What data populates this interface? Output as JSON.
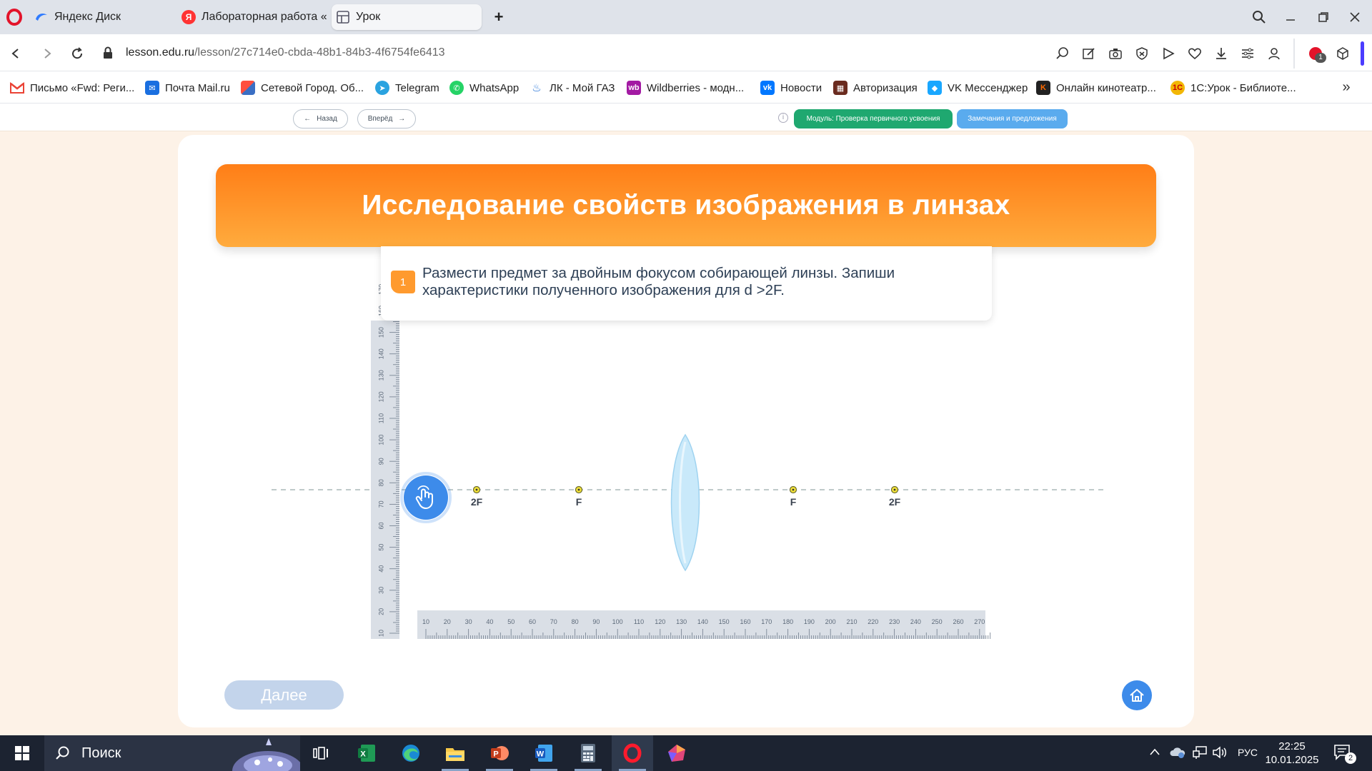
{
  "browser": {
    "tabs": [
      {
        "label": "Яндекс Диск",
        "icon": "yandex-disk-icon"
      },
      {
        "label": "Лабораторная работа «И",
        "icon": "yandex-icon"
      },
      {
        "label": "Урок",
        "icon": "lesson-page-icon",
        "active": true
      }
    ],
    "new_tab": "+",
    "url_host": "lesson.edu.ru",
    "url_path": "/lesson/27c714e0-cbda-48b1-84b3-4f6754fe6413",
    "extension_badge": "1",
    "bookmarks": [
      {
        "label": "Письмо «Fwd: Реги...",
        "icon": "gmail-icon",
        "color": "#ea4335"
      },
      {
        "label": "Почта Mail.ru",
        "icon": "mail-ru-icon",
        "color": "#1a6fe0"
      },
      {
        "label": "Сетевой Город. Об...",
        "icon": "school-portal-icon",
        "color": "#3b6fc4"
      },
      {
        "label": "Telegram",
        "icon": "telegram-icon",
        "color": "#2aa3e0"
      },
      {
        "label": "WhatsApp",
        "icon": "whatsapp-icon",
        "color": "#25d366"
      },
      {
        "label": "ЛК - Мой ГАЗ",
        "icon": "gas-flame-icon",
        "color": "#1f6fd6"
      },
      {
        "label": "Wildberries - модн...",
        "icon": "wildberries-icon",
        "color": "#a31aa3"
      },
      {
        "label": "Новости",
        "icon": "vk-icon",
        "color": "#0077ff"
      },
      {
        "label": "Авторизация",
        "icon": "auth-icon",
        "color": "#6a2b1f"
      },
      {
        "label": "VK Мессенджер",
        "icon": "vk-messenger-icon",
        "color": "#19a7ff"
      },
      {
        "label": "Онлайн кинотеатр...",
        "icon": "kinopoisk-icon",
        "color": "#222222"
      },
      {
        "label": "1С:Урок - Библиоте...",
        "icon": "1c-icon",
        "color": "#f2b705"
      }
    ]
  },
  "lesson": {
    "back_label": "Назад",
    "forward_label": "Вперёд",
    "module_label": "Модуль: Проверка первичного усвоения",
    "feedback_label": "Замечания и предложения",
    "title": "Исследование свойств изображения в линзах",
    "task_number": "1",
    "task_text": "Размести предмет за двойным фокусом собирающей линзы. Запиши характеристики полученного изображения для d >2F.",
    "next_label": "Далее",
    "focal_labels": [
      "2F",
      "F",
      "F",
      "2F"
    ],
    "ruler_h_ticks": [
      "10",
      "20",
      "30",
      "40",
      "50",
      "60",
      "70",
      "80",
      "90",
      "100",
      "110",
      "120",
      "130",
      "140",
      "150",
      "160",
      "170",
      "180",
      "190",
      "200",
      "210",
      "220",
      "230",
      "240",
      "250",
      "260",
      "270"
    ],
    "ruler_v_ticks": [
      "10",
      "20",
      "30",
      "40",
      "50",
      "60",
      "70",
      "80",
      "90",
      "100",
      "110",
      "120",
      "130",
      "140",
      "150",
      "160",
      "170"
    ],
    "colors": {
      "accent_orange": "#ff8a1f",
      "button_blue": "#3d8bea",
      "module_green": "#1fa870",
      "feedback_blue": "#5aabee"
    }
  },
  "taskbar": {
    "search_label": "Поиск",
    "lang": "РУС",
    "time": "22:25",
    "date": "10.01.2025",
    "notif_count": "2"
  }
}
